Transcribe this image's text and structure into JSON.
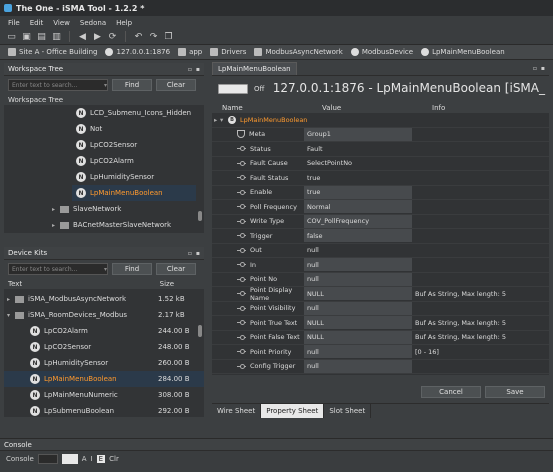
{
  "app": {
    "title": "The One - iSMA Tool - 1.2.2 *"
  },
  "menu": [
    "File",
    "Edit",
    "View",
    "Sedona",
    "Help"
  ],
  "breadcrumbs": [
    "Site A - Office Building",
    "127.0.0.1:1876",
    "app",
    "Drivers",
    "ModbusAsyncNetwork",
    "ModbusDevice",
    "LpMainMenuBoolean"
  ],
  "workspace": {
    "header": "Workspace Tree",
    "search_placeholder": "Enter text to search...",
    "find": "Find",
    "clear": "Clear",
    "subheader": "Workspace Tree",
    "items": [
      {
        "label": "LCD_Submenu_Icons_Hidden",
        "icon": "N"
      },
      {
        "label": "Not",
        "icon": "N"
      },
      {
        "label": "LpCO2Sensor",
        "icon": "N"
      },
      {
        "label": "LpCO2Alarm",
        "icon": "N"
      },
      {
        "label": "LpHumiditySensor",
        "icon": "N"
      },
      {
        "label": "LpMainMenuBoolean",
        "icon": "N"
      },
      {
        "label": "SlaveNetwork",
        "icon": "folder"
      },
      {
        "label": "BACnetMasterSlaveNetwork",
        "icon": "folder"
      }
    ]
  },
  "devicekits": {
    "header": "Device Kits",
    "search_placeholder": "Enter text to search...",
    "find": "Find",
    "clear": "Clear",
    "col_text": "Text",
    "col_size": "Size",
    "items": [
      {
        "label": "iSMA_ModbusAsyncNetwork",
        "size": "1.52 kB",
        "icon": "kit"
      },
      {
        "label": "iSMA_RoomDevices_Modbus",
        "size": "2.17 kB",
        "icon": "kit"
      },
      {
        "label": "LpCO2Alarm",
        "size": "244.00 B",
        "icon": "N"
      },
      {
        "label": "LpCO2Sensor",
        "size": "248.00 B",
        "icon": "N"
      },
      {
        "label": "LpHumiditySensor",
        "size": "260.00 B",
        "icon": "N"
      },
      {
        "label": "LpMainMenuBoolean",
        "size": "284.00 B",
        "icon": "N"
      },
      {
        "label": "LpMainMenuNumeric",
        "size": "308.00 B",
        "icon": "N"
      },
      {
        "label": "LpSubmenuBoolean",
        "size": "292.00 B",
        "icon": "N"
      }
    ]
  },
  "editor": {
    "tab": "LpMainMenuBoolean",
    "toggle_label": "Off",
    "title": "127.0.0.1:1876 - LpMainMenuBoolean [iSMA_",
    "col_name": "Name",
    "col_value": "Value",
    "col_info": "Info",
    "root": "LpMainMenuBoolean",
    "props": [
      {
        "name": "Meta",
        "value": "Group1",
        "info": "",
        "edit": true,
        "icon": "shield"
      },
      {
        "name": "Status",
        "value": "Fault",
        "info": "",
        "edit": false,
        "icon": "slot"
      },
      {
        "name": "Fault Cause",
        "value": "SelectPointNo",
        "info": "",
        "edit": false,
        "icon": "slot"
      },
      {
        "name": "Fault Status",
        "value": "true",
        "info": "",
        "edit": false,
        "icon": "slot"
      },
      {
        "name": "Enable",
        "value": "true",
        "info": "",
        "edit": true,
        "icon": "slot"
      },
      {
        "name": "Poll Frequency",
        "value": "Normal",
        "info": "",
        "edit": true,
        "icon": "slot"
      },
      {
        "name": "Write Type",
        "value": "COV_PollFrequency",
        "info": "",
        "edit": true,
        "icon": "slot"
      },
      {
        "name": "Trigger",
        "value": "false",
        "info": "",
        "edit": true,
        "icon": "slot"
      },
      {
        "name": "Out",
        "value": "null",
        "info": "",
        "edit": false,
        "icon": "slot"
      },
      {
        "name": "In",
        "value": "null",
        "info": "",
        "edit": true,
        "icon": "slot"
      },
      {
        "name": "Point No",
        "value": "null",
        "info": "",
        "edit": true,
        "icon": "slot"
      },
      {
        "name": "Point Display Name",
        "value": "NULL",
        "info": "Buf As String, Max length: 5",
        "edit": true,
        "icon": "slot"
      },
      {
        "name": "Point Visibility",
        "value": "null",
        "info": "",
        "edit": true,
        "icon": "slot"
      },
      {
        "name": "Point True Text",
        "value": "NULL",
        "info": "Buf As String, Max length: 5",
        "edit": true,
        "icon": "slot"
      },
      {
        "name": "Point False Text",
        "value": "NULL",
        "info": "Buf As String, Max length: 5",
        "edit": true,
        "icon": "slot"
      },
      {
        "name": "Point Priority",
        "value": "null",
        "info": "[0 - 16]",
        "edit": true,
        "icon": "slot"
      },
      {
        "name": "Config Trigger",
        "value": "null",
        "info": "",
        "edit": true,
        "icon": "slot"
      }
    ],
    "cancel": "Cancel",
    "save": "Save",
    "bottom_tabs": [
      "Wire Sheet",
      "Property Sheet",
      "Slot Sheet"
    ]
  },
  "console": {
    "header": "Console",
    "label": "Console",
    "buttons": [
      "A",
      "I",
      "E",
      "Clr"
    ]
  }
}
